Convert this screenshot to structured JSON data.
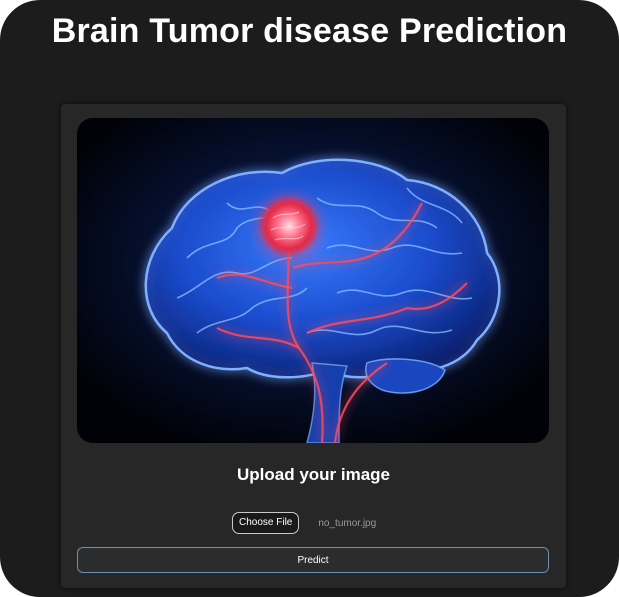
{
  "header": {
    "title": "Brain Tumor disease Prediction"
  },
  "card": {
    "hero_image": "brain-tumor-illustration",
    "upload_heading": "Upload your image",
    "file_input": {
      "button_label": "Choose File",
      "selected_file": "no_tumor.jpg"
    },
    "predict_label": "Predict"
  },
  "colors": {
    "page_background": "#1c1c1c",
    "card_background": "#272728",
    "predict_border": "#6d8fb0",
    "brain_glow": "#2f6bff",
    "tumor_glow": "#ff4a5a"
  }
}
